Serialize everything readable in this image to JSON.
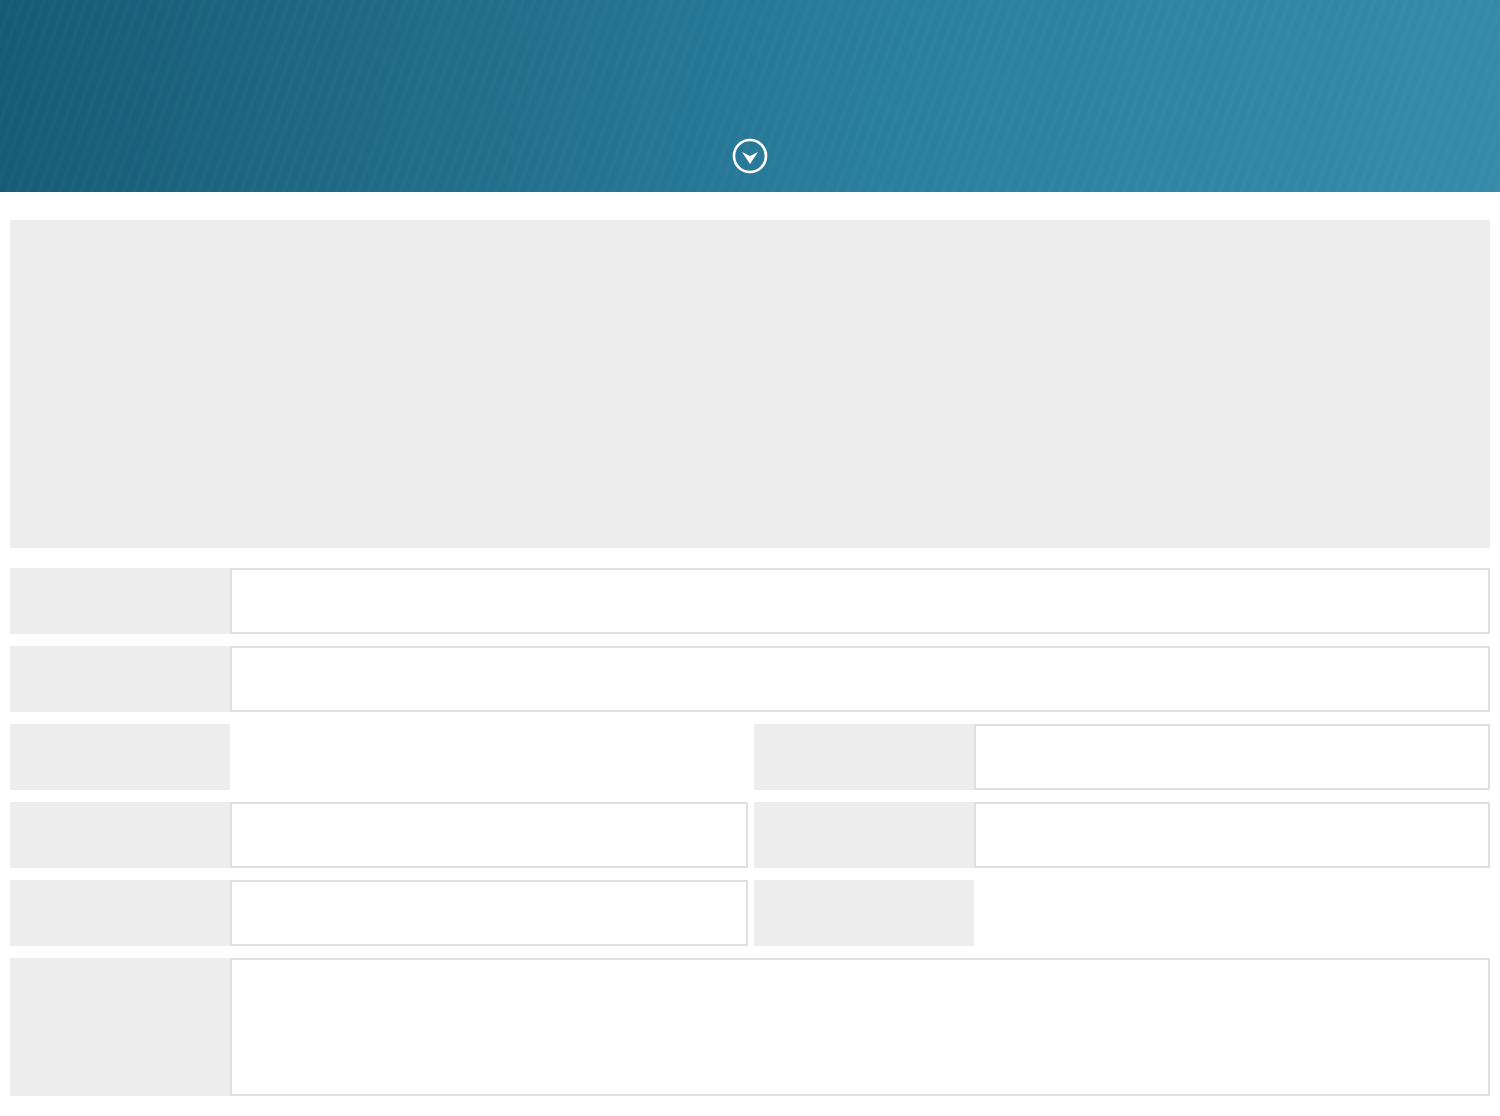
{
  "header": {
    "toggle": {
      "expanded": false
    }
  },
  "summary_panel": {
    "kind": "blank"
  },
  "form_rows": [
    {
      "kind": "single",
      "cells": [
        {
          "has_value_box": true
        }
      ]
    },
    {
      "kind": "single",
      "cells": [
        {
          "has_value_box": true
        }
      ]
    },
    {
      "kind": "pair",
      "cells": [
        {
          "has_value_box": false
        },
        {
          "has_value_box": true
        }
      ]
    },
    {
      "kind": "pair",
      "cells": [
        {
          "has_value_box": true
        },
        {
          "has_value_box": true
        }
      ]
    },
    {
      "kind": "pair",
      "cells": [
        {
          "has_value_box": true
        },
        {
          "has_value_box": false
        }
      ]
    },
    {
      "kind": "tall",
      "cells": [
        {
          "has_value_box": true
        }
      ]
    }
  ]
}
